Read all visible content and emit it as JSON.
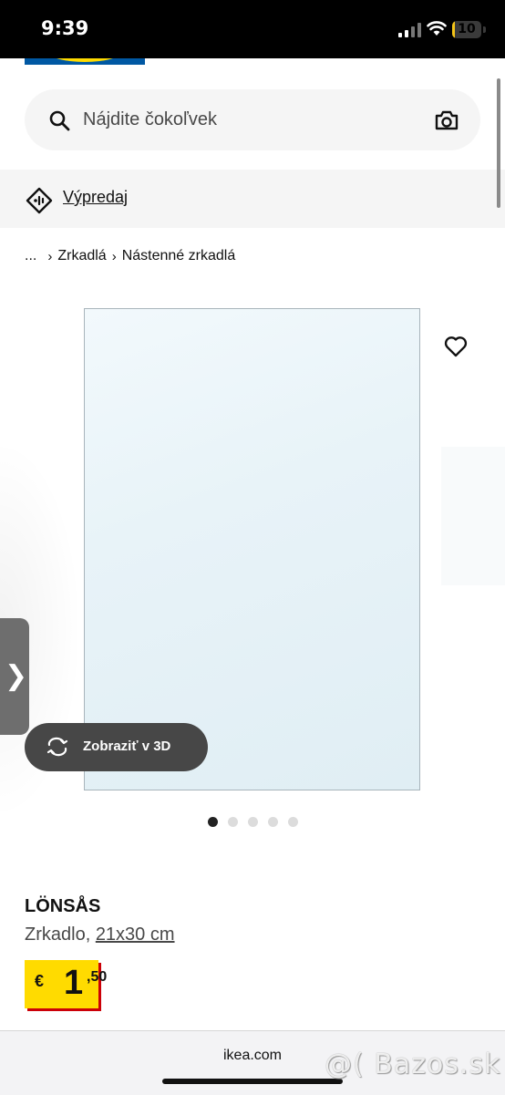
{
  "status_bar": {
    "time": "9:39",
    "battery": "10",
    "battery_level": 0.1
  },
  "search": {
    "placeholder": "Nájdite čokoľvek"
  },
  "promo": {
    "link_label": "Výpredaj"
  },
  "breadcrumb": {
    "ellipsis": "...",
    "items": [
      "Zrkadlá",
      "Nástenné zrkadlá"
    ]
  },
  "gallery": {
    "view_3d_label": "Zobraziť v 3D",
    "dots_total": 5,
    "active_dot": 1,
    "side_tab_glyph": "❯"
  },
  "product": {
    "name": "LÖNSÅS",
    "type": "Zrkadlo,",
    "size": "21x30 cm"
  },
  "price": {
    "currency": "€",
    "integer": "1",
    "decimal": ",50"
  },
  "browser": {
    "url": "ikea.com"
  },
  "watermark": {
    "text": "@( Bazos.sk"
  },
  "colors": {
    "brand_blue": "#0058a3",
    "brand_yellow": "#ffdb00",
    "price_shadow": "#cc0008"
  }
}
